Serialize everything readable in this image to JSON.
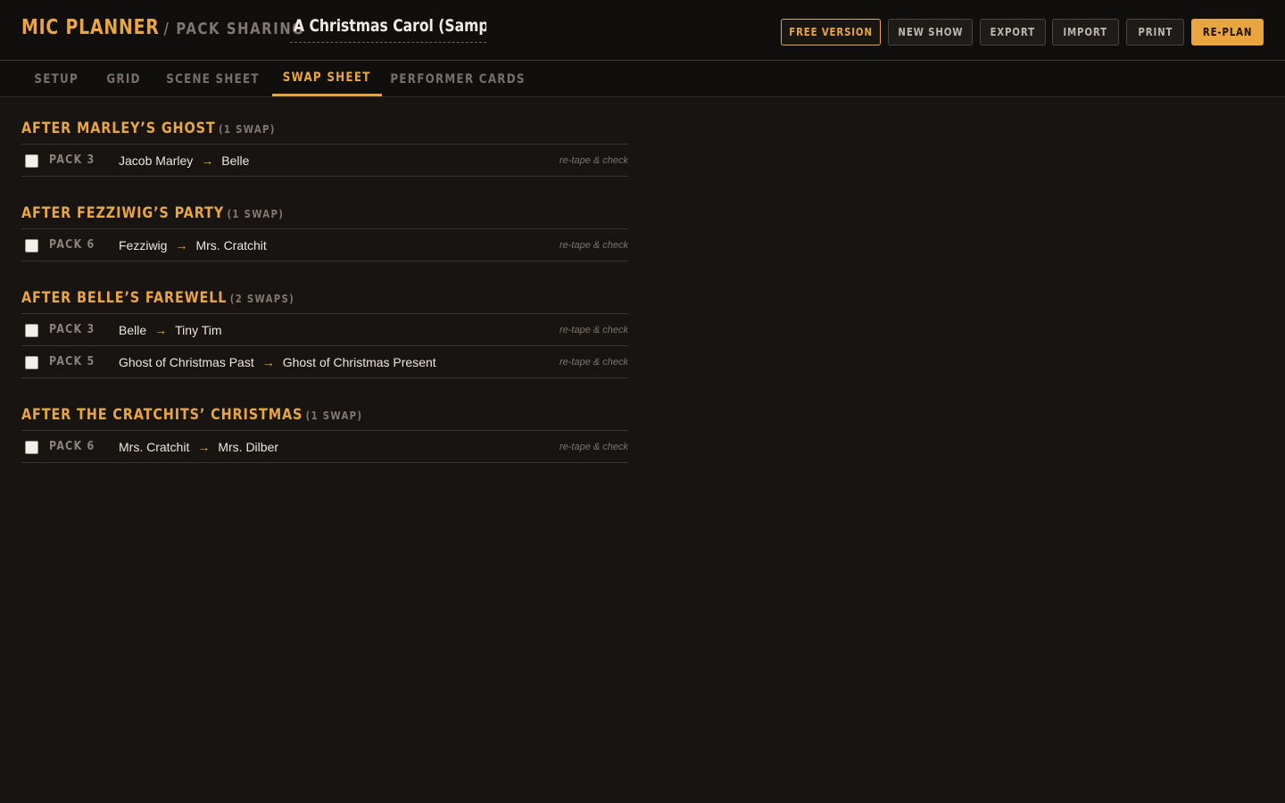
{
  "header": {
    "brand": "MIC PLANNER",
    "brand_sub": "/ PACK SHARING",
    "show_title": "A Christmas Carol (Sample",
    "buttons": {
      "free_version": "FREE VERSION",
      "new_show": "NEW SHOW",
      "export": "EXPORT",
      "import": "IMPORT",
      "print": "PRINT",
      "replan": "RE-PLAN"
    }
  },
  "tabs": {
    "setup": "SETUP",
    "grid": "GRID",
    "scene_sheet": "SCENE SHEET",
    "swap_sheet": "SWAP SHEET",
    "performer_cards": "PERFORMER CARDS",
    "active": "SWAP SHEET"
  },
  "groups": [
    {
      "title": "AFTER MARLEY’S GHOST",
      "count": "(1 SWAP)",
      "rows": [
        {
          "pack": "PACK 3",
          "from": "Jacob Marley",
          "arrow": "→",
          "to": "Belle",
          "note": "re-tape & check",
          "checked": false
        }
      ]
    },
    {
      "title": "AFTER FEZZIWIG’S PARTY",
      "count": "(1 SWAP)",
      "rows": [
        {
          "pack": "PACK 6",
          "from": "Fezziwig",
          "arrow": "→",
          "to": "Mrs. Cratchit",
          "note": "re-tape & check",
          "checked": false
        }
      ]
    },
    {
      "title": "AFTER BELLE’S FAREWELL",
      "count": "(2 SWAPS)",
      "rows": [
        {
          "pack": "PACK 3",
          "from": "Belle",
          "arrow": "→",
          "to": "Tiny Tim",
          "note": "re-tape & check",
          "checked": false
        },
        {
          "pack": "PACK 5",
          "from": "Ghost of Christmas Past",
          "arrow": "→",
          "to": "Ghost of Christmas Present",
          "note": "re-tape & check",
          "checked": false
        }
      ]
    },
    {
      "title": "AFTER THE CRATCHITS’ CHRISTMAS",
      "count": "(1 SWAP)",
      "rows": [
        {
          "pack": "PACK 6",
          "from": "Mrs. Cratchit",
          "arrow": "→",
          "to": "Mrs. Dilber",
          "note": "re-tape & check",
          "checked": false
        }
      ]
    }
  ],
  "colors": {
    "accent": "#e9a640",
    "background": "#171412",
    "header_bg": "#110f0d"
  }
}
